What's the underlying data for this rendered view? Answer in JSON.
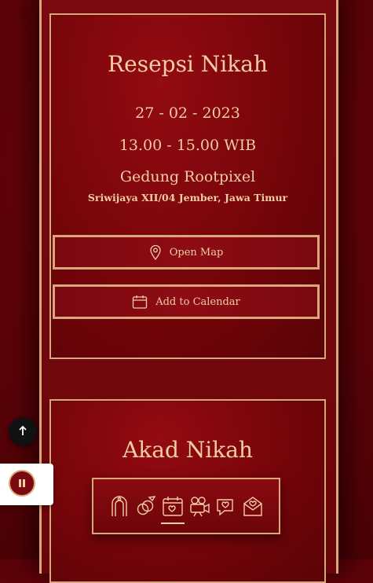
{
  "reception": {
    "title": "Resepsi Nikah",
    "date": "27 - 02 - 2023",
    "time": "13.00 - 15.00 WIB",
    "venue": "Gedung Rootpixel",
    "address": "Sriwijaya XII/04 Jember, Jawa Timur",
    "map_button": "Open Map",
    "calendar_button": "Add to Calendar"
  },
  "akad": {
    "title": "Akad Nikah"
  },
  "nav": {
    "items": [
      "arch-icon",
      "rings-icon",
      "calendar-hearts-icon",
      "video-camera-icon",
      "chat-hearts-icon",
      "envelope-heart-icon"
    ],
    "active_index": 2
  },
  "controls": {
    "scroll_top_icon": "arrow-up-icon",
    "music_icon": "pause-icon"
  },
  "colors": {
    "accent_gold": "#d9a87a",
    "text_gold": "#f3cda3",
    "background_red": "#7a0910"
  }
}
